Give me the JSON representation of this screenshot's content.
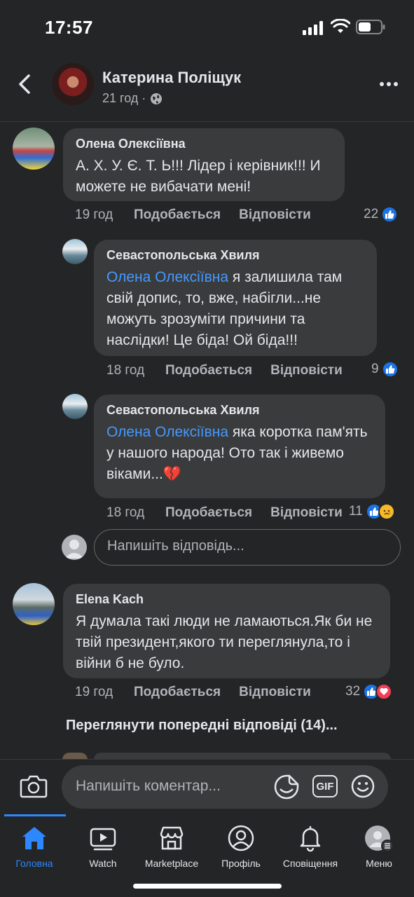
{
  "status_bar": {
    "time": "17:57"
  },
  "header": {
    "title": "Катерина Поліщук",
    "meta": "21 год ·",
    "icons": [
      "back-icon",
      "globe-icon",
      "more-icon"
    ]
  },
  "comments": [
    {
      "author": "Олена Олексіївна",
      "text": "А. Х. У. Є. Т. Ь!!! Лідер і керівник!!! И можете не вибачати  мені!",
      "time": "19 год",
      "like_label": "Подобається",
      "reply_label": "Відповісти",
      "reaction_count": "22"
    },
    {
      "author": "Севастопольська Хвиля",
      "mention": "Олена Олексіївна",
      "text": " я залишила там свій допис, то, вже, набігли...не можуть зрозуміти причини та наслідки! Це біда! Ой біда!!!",
      "time": "18 год",
      "like_label": "Подобається",
      "reply_label": "Відповісти",
      "reaction_count": "9"
    },
    {
      "author": "Севастопольська Хвиля",
      "mention": "Олена Олексіївна",
      "text": " яка коротка пам'ять у нашого народа! Ото так і живемо віками...💔",
      "time": "18 год",
      "like_label": "Подобається",
      "reply_label": "Відповісти",
      "reaction_count": "11"
    },
    {
      "author": "Elena Kach",
      "text": "Я думала такі люди не ламаються.Як би не твій президент,якого ти переглянула,то і війни б не було.",
      "time": "19 год",
      "like_label": "Подобається",
      "reply_label": "Відповісти",
      "reaction_count": "32"
    }
  ],
  "reply_box": {
    "placeholder": "Напишіть відповідь..."
  },
  "view_previous": "Переглянути попередні відповіді (14)...",
  "composer": {
    "placeholder": "Напишіть коментар...",
    "gif_label": "GIF"
  },
  "tabs": [
    {
      "label": "Головна",
      "icon": "home-icon",
      "active": true
    },
    {
      "label": "Watch",
      "icon": "watch-icon"
    },
    {
      "label": "Marketplace",
      "icon": "marketplace-icon"
    },
    {
      "label": "Профіль",
      "icon": "profile-icon"
    },
    {
      "label": "Сповіщення",
      "icon": "bell-icon"
    },
    {
      "label": "Меню",
      "icon": "menu-avatar-icon"
    }
  ],
  "colors": {
    "background": "#242526",
    "bubble": "#3a3b3c",
    "accent": "#2d88ff",
    "mention": "#4599ff",
    "like": "#1b74e4",
    "love": "#f33e58"
  }
}
